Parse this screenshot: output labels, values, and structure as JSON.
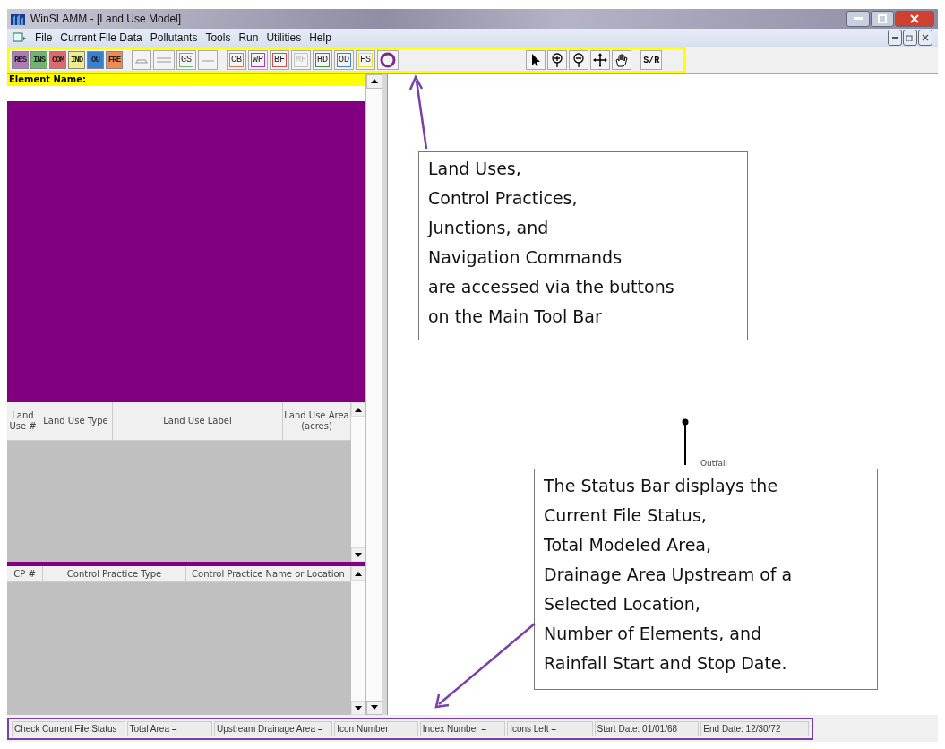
{
  "window": {
    "title": "WinSLAMM - [Land Use Model]"
  },
  "menu": [
    "File",
    "Current File Data",
    "Pollutants",
    "Tools",
    "Run",
    "Utilities",
    "Help"
  ],
  "toolbar": {
    "land_uses": [
      {
        "label": "RES",
        "color": "#b07ab8"
      },
      {
        "label": "INS",
        "color": "#6fb56f"
      },
      {
        "label": "COM",
        "color": "#e06a6a"
      },
      {
        "label": "IND",
        "color": "#eeee88"
      },
      {
        "label": "OU",
        "color": "#3b7fd0"
      },
      {
        "label": "FRE",
        "color": "#f08a50"
      }
    ],
    "junctions": [
      {
        "kind": "pipe"
      },
      {
        "kind": "channel"
      },
      {
        "kind": "text",
        "label": "GS",
        "color": "#6fb56f"
      },
      {
        "kind": "line"
      }
    ],
    "controls": [
      {
        "label": "CB",
        "color": "#e07a50",
        "disabled": false
      },
      {
        "label": "WP",
        "color": "#a040c0",
        "disabled": false
      },
      {
        "label": "BF",
        "color": "#d05050",
        "disabled": false
      },
      {
        "label": "MF",
        "color": "#c0c0c0",
        "disabled": true
      },
      {
        "label": "HD",
        "color": "#409040",
        "disabled": false
      },
      {
        "label": "OD",
        "color": "#4a80c0",
        "disabled": false
      },
      {
        "label": "FS",
        "color": "#e0e040",
        "disabled": false
      },
      {
        "kind": "outfall-circle",
        "color": "#7b2a8a",
        "disabled": false
      }
    ],
    "navigation": [
      {
        "kind": "pointer"
      },
      {
        "kind": "zoom-in"
      },
      {
        "kind": "zoom-out"
      },
      {
        "kind": "move"
      },
      {
        "kind": "hand"
      },
      {
        "kind": "text",
        "label": "S/R"
      }
    ]
  },
  "element_name": {
    "label": "Element Name:"
  },
  "land_use_table": {
    "columns": [
      "Land Use #",
      "Land Use Type",
      "Land Use Label",
      "Land Use Area (acres)"
    ]
  },
  "control_practice_table": {
    "columns": [
      "CP #",
      "Control Practice Type",
      "Control Practice Name or Location"
    ]
  },
  "canvas": {
    "outfall_label": "Outfall"
  },
  "callouts": [
    {
      "text": "Land Uses,\nControl Practices,\nJunctions, and\nNavigation Commands\nare accessed via the buttons\non the Main Tool Bar"
    },
    {
      "text": "The Status Bar displays the\nCurrent File Status,\nTotal Modeled Area,\nDrainage Area Upstream of a\nSelected Location,\nNumber of Elements, and\nRainfall Start and Stop Date."
    }
  ],
  "status_bar": [
    "Check Current File Status",
    "Total Area =",
    "Upstream Drainage Area =",
    "Icon Number",
    "Index Number =",
    "Icons Left =",
    "Start Date:  01/01/68",
    "End Date:  12/30/72"
  ]
}
